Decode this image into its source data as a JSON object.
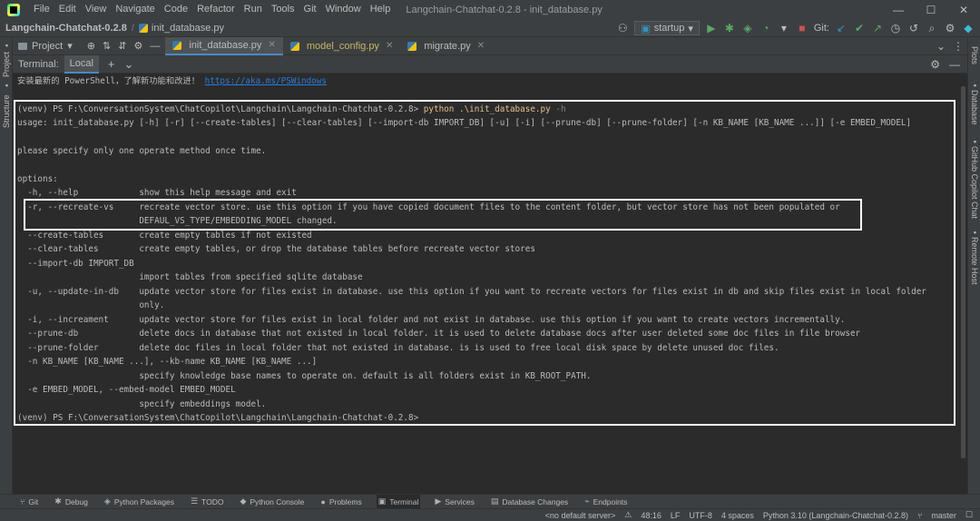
{
  "menu": {
    "items": [
      "File",
      "Edit",
      "View",
      "Navigate",
      "Code",
      "Refactor",
      "Run",
      "Tools",
      "Git",
      "Window",
      "Help"
    ],
    "window_title": "Langchain-Chatchat-0.2.8 - init_database.py"
  },
  "nav": {
    "project": "Langchain-Chatchat-0.2.8",
    "file": "init_database.py",
    "run_config": "startup",
    "git_label": "Git:"
  },
  "left_tools": {
    "project": "Project",
    "structure": "Structure"
  },
  "right_tools": {
    "plots": "Plots",
    "database": "Database",
    "copilot": "GitHub Copilot Chat",
    "remote": "Remote Host"
  },
  "editor": {
    "project_tool_label": "Project",
    "tabs": [
      {
        "label": "init_database.py",
        "active": true,
        "modified": false
      },
      {
        "label": "model_config.py",
        "active": false,
        "modified": true
      },
      {
        "label": "migrate.py",
        "active": false,
        "modified": false
      }
    ]
  },
  "terminal": {
    "title": "Terminal:",
    "tab": "Local",
    "powershell_notice": "安装最新的 PowerShell，了解新功能和改进！",
    "powershell_link": "https://aka.ms/PSWindows",
    "prompt": "(venv) PS F:\\ConversationSystem\\ChatCopilot\\Langchain\\Langchain-Chatchat-0.2.8>",
    "command": "python .\\init_database.py",
    "command_flag": "-h",
    "lines": [
      "usage: init_database.py [-h] [-r] [--create-tables] [--clear-tables] [--import-db IMPORT_DB] [-u] [-i] [--prune-db] [--prune-folder] [-n KB_NAME [KB_NAME ...]] [-e EMBED_MODEL]",
      "",
      "please specify only one operate method once time.",
      "",
      "options:",
      "  -h, --help            show this help message and exit",
      "  -r, --recreate-vs     recreate vector store. use this option if you have copied document files to the content folder, but vector store has not been populated or",
      "                        DEFAUL_VS_TYPE/EMBEDDING_MODEL changed.",
      "  --create-tables       create empty tables if not existed",
      "  --clear-tables        create empty tables, or drop the database tables before recreate vector stores",
      "  --import-db IMPORT_DB",
      "                        import tables from specified sqlite database",
      "  -u, --update-in-db    update vector store for files exist in database. use this option if you want to recreate vectors for files exist in db and skip files exist in local folder",
      "                        only.",
      "  -i, --increament      update vector store for files exist in local folder and not exist in database. use this option if you want to create vectors incrementally.",
      "  --prune-db            delete docs in database that not existed in local folder. it is used to delete database docs after user deleted some doc files in file browser",
      "  --prune-folder        delete doc files in local folder that not existed in database. is is used to free local disk space by delete unused doc files.",
      "  -n KB_NAME [KB_NAME ...], --kb-name KB_NAME [KB_NAME ...]",
      "                        specify knowledge base names to operate on. default is all folders exist in KB_ROOT_PATH.",
      "  -e EMBED_MODEL, --embed-model EMBED_MODEL",
      "                        specify embeddings model."
    ]
  },
  "bottom_tools": [
    {
      "label": "Git",
      "icon": "git-icon"
    },
    {
      "label": "Debug",
      "icon": "debug-icon"
    },
    {
      "label": "Python Packages",
      "icon": "packages-icon"
    },
    {
      "label": "TODO",
      "icon": "todo-icon"
    },
    {
      "label": "Python Console",
      "icon": "python-console-icon"
    },
    {
      "label": "Problems",
      "icon": "problems-icon"
    },
    {
      "label": "Terminal",
      "icon": "terminal-icon",
      "active": true
    },
    {
      "label": "Services",
      "icon": "services-icon"
    },
    {
      "label": "Database Changes",
      "icon": "database-changes-icon"
    },
    {
      "label": "Endpoints",
      "icon": "endpoints-icon"
    }
  ],
  "status": {
    "server": "<no default server>",
    "position": "48:16",
    "line_sep": "LF",
    "encoding": "UTF-8",
    "indent": "4 spaces",
    "interpreter": "Python 3.10 (Langchain-Chatchat-0.2.8)",
    "branch": "master"
  }
}
